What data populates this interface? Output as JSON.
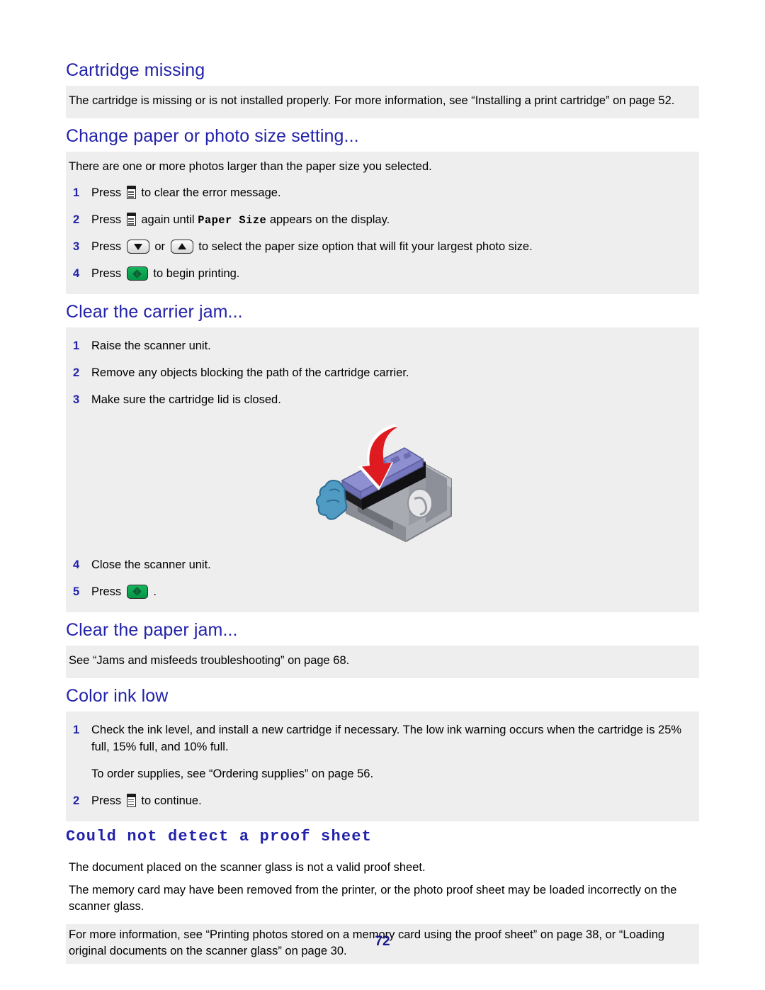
{
  "document": {
    "page_number": "72",
    "heading_color": "#2222aa",
    "shade_color": "#eeeeee"
  },
  "sections": [
    {
      "id": "cartridge-missing",
      "heading": "Cartridge missing",
      "paragraph": "The cartridge is missing or is not installed properly. For more information, see “Installing a print cartridge” on page 52."
    },
    {
      "id": "change-paper-or-photo-size-setting",
      "heading": "Change paper or photo size setting...",
      "paragraph": "There are one or more photos larger than the paper size you selected.",
      "steps": [
        {
          "num": "1",
          "before": "Press",
          "icon": "menu-button-icon",
          "after": "to clear the error message."
        },
        {
          "num": "2",
          "before": "Press",
          "icon": "menu-button-icon",
          "after": "again until",
          "code": "Paper Size",
          "tail": "appears on the display."
        },
        {
          "num": "3",
          "before": "Press",
          "icon": "arrow-down-button-icon",
          "middle": "or",
          "icon2": "arrow-up-button-icon",
          "after": "to select the paper size option that will fit your largest photo size."
        },
        {
          "num": "4",
          "before": "Press",
          "icon": "start-button-icon",
          "after": "to begin printing."
        }
      ]
    },
    {
      "id": "clear-the-carrier-jam",
      "heading": "Clear the carrier jam...",
      "steps": [
        {
          "num": "1",
          "text": "Raise the scanner unit."
        },
        {
          "num": "2",
          "text": "Remove any objects blocking the path of the cartridge carrier."
        },
        {
          "num": "3",
          "text": "Make sure the cartridge lid is closed."
        },
        {
          "num": "4",
          "text": "Close the scanner unit."
        },
        {
          "num": "5",
          "before": "Press",
          "icon": "start-button-icon",
          "after": "."
        }
      ],
      "figure": {
        "name": "print-cartridge-install-illustration",
        "description": "Print cartridge being lowered into the cartridge carrier, indicated by a red downward curved arrow"
      }
    },
    {
      "id": "clear-the-paper-jam",
      "heading": "Clear the paper jam...",
      "paragraph": "See “Jams and misfeeds troubleshooting” on page 68."
    },
    {
      "id": "color-ink-low",
      "heading": "Color ink low",
      "steps": [
        {
          "num": "1",
          "text": "Check the ink level, and install a new cartridge if necessary. The low ink warning occurs when the cartridge is 25% full, 15% full, and 10% full.",
          "substep": "To order supplies, see “Ordering supplies” on page 56."
        },
        {
          "num": "2",
          "before": "Press",
          "icon": "menu-button-icon",
          "after": "to continue."
        }
      ]
    },
    {
      "id": "could-not-detect-a-proof-sheet",
      "heading": "Could not detect a proof sheet",
      "paragraphs": [
        "The document placed on the scanner glass is not a valid proof sheet.",
        "The memory card may have been removed from the printer, or the photo proof sheet may be loaded incorrectly on the scanner glass.",
        "For more information, see “Printing photos stored on a memory card using the proof sheet” on page 38, or “Loading original documents on the scanner glass” on page 30."
      ]
    }
  ]
}
